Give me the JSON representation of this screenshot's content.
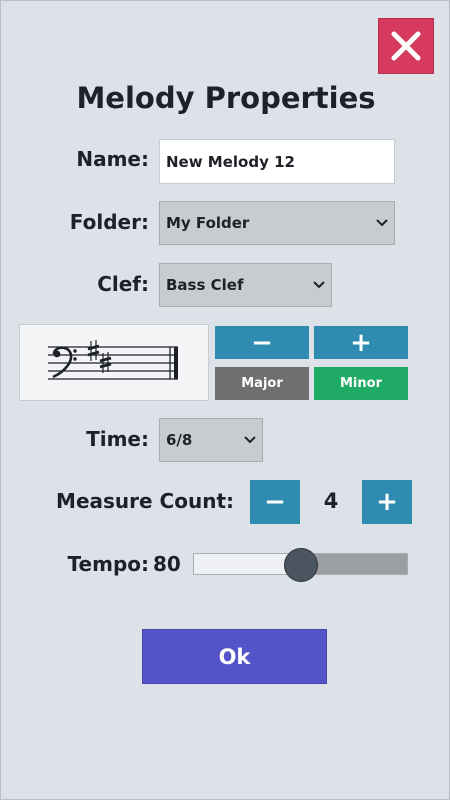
{
  "title": "Melody Properties",
  "name": {
    "label": "Name:",
    "value": "New Melody 12"
  },
  "folder": {
    "label": "Folder:",
    "value": "My Folder"
  },
  "clef": {
    "label": "Clef:",
    "value": "Bass Clef"
  },
  "key": {
    "minus_label": "−",
    "plus_label": "+",
    "major_label": "Major",
    "minor_label": "Minor",
    "sharps": 2,
    "mode": "Minor"
  },
  "time": {
    "label": "Time:",
    "value": "6/8"
  },
  "measure": {
    "label": "Measure Count:",
    "value": "4",
    "minus_label": "−",
    "plus_label": "+"
  },
  "tempo": {
    "label": "Tempo:",
    "value": "80",
    "fraction": 0.5
  },
  "ok_label": "Ok",
  "icons": {
    "close": "close-icon",
    "select_chevron": "chevron-down-icon",
    "bass_clef": "bass-clef-icon",
    "sharp": "sharp-icon"
  },
  "colors": {
    "close": "#d63b5f",
    "blue_button": "#2f8bb0",
    "major_button": "#6f6f6f",
    "minor_button": "#1faa66",
    "ok_button": "#5454c9",
    "background": "#dde1e8"
  }
}
